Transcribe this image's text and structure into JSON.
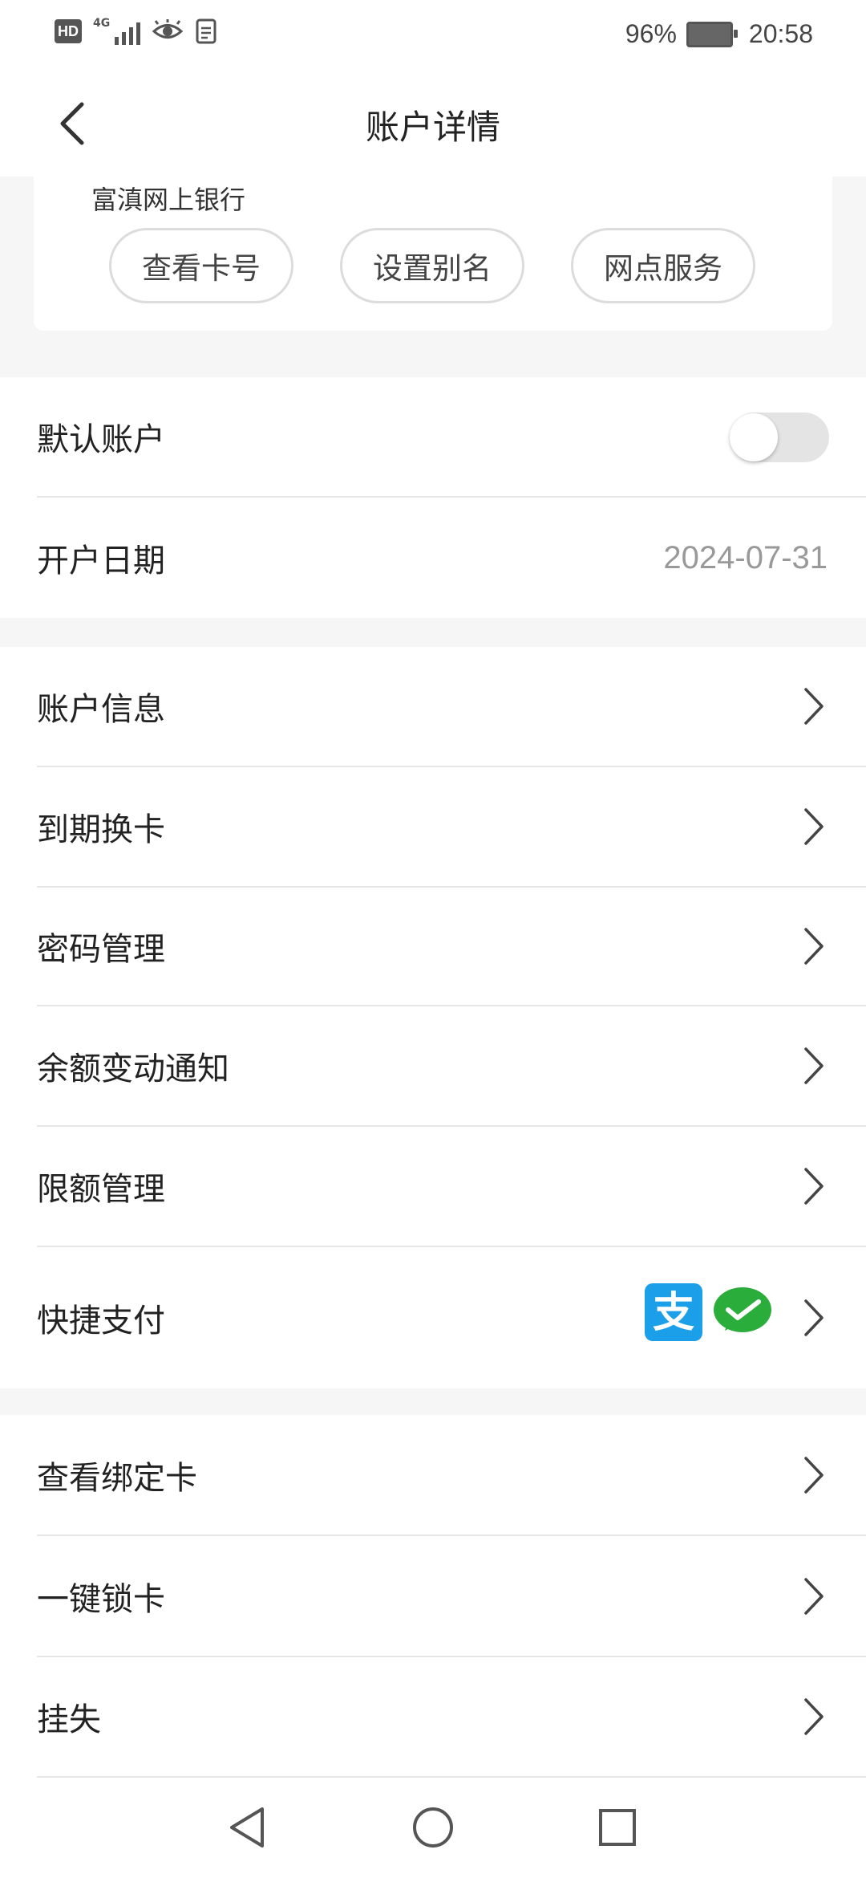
{
  "status_bar": {
    "hd": "HD",
    "network": "4G",
    "battery_percent": "96%",
    "time": "20:58"
  },
  "header": {
    "title": "账户详情",
    "back_icon": "chevron-left-icon"
  },
  "card": {
    "bank_name": "富滇网上银行",
    "buttons": [
      "查看卡号",
      "设置别名",
      "网点服务"
    ]
  },
  "section1": {
    "default_account_label": "默认账户",
    "default_account_enabled": false,
    "open_date_label": "开户日期",
    "open_date_value": "2024-07-31"
  },
  "section2": {
    "items": [
      "账户信息",
      "到期换卡",
      "密码管理",
      "余额变动通知",
      "限额管理",
      "快捷支付"
    ],
    "quick_pay_icons": [
      "alipay-icon",
      "wechat-pay-icon"
    ],
    "alipay_glyph": "支",
    "colors": {
      "alipay": "#1a9fe8",
      "wechat": "#2bad3c"
    }
  },
  "section3": {
    "items": [
      "查看绑定卡",
      "一键锁卡",
      "挂失"
    ]
  },
  "nav": {
    "icons": [
      "back-triangle-icon",
      "home-circle-icon",
      "recents-square-icon"
    ]
  }
}
